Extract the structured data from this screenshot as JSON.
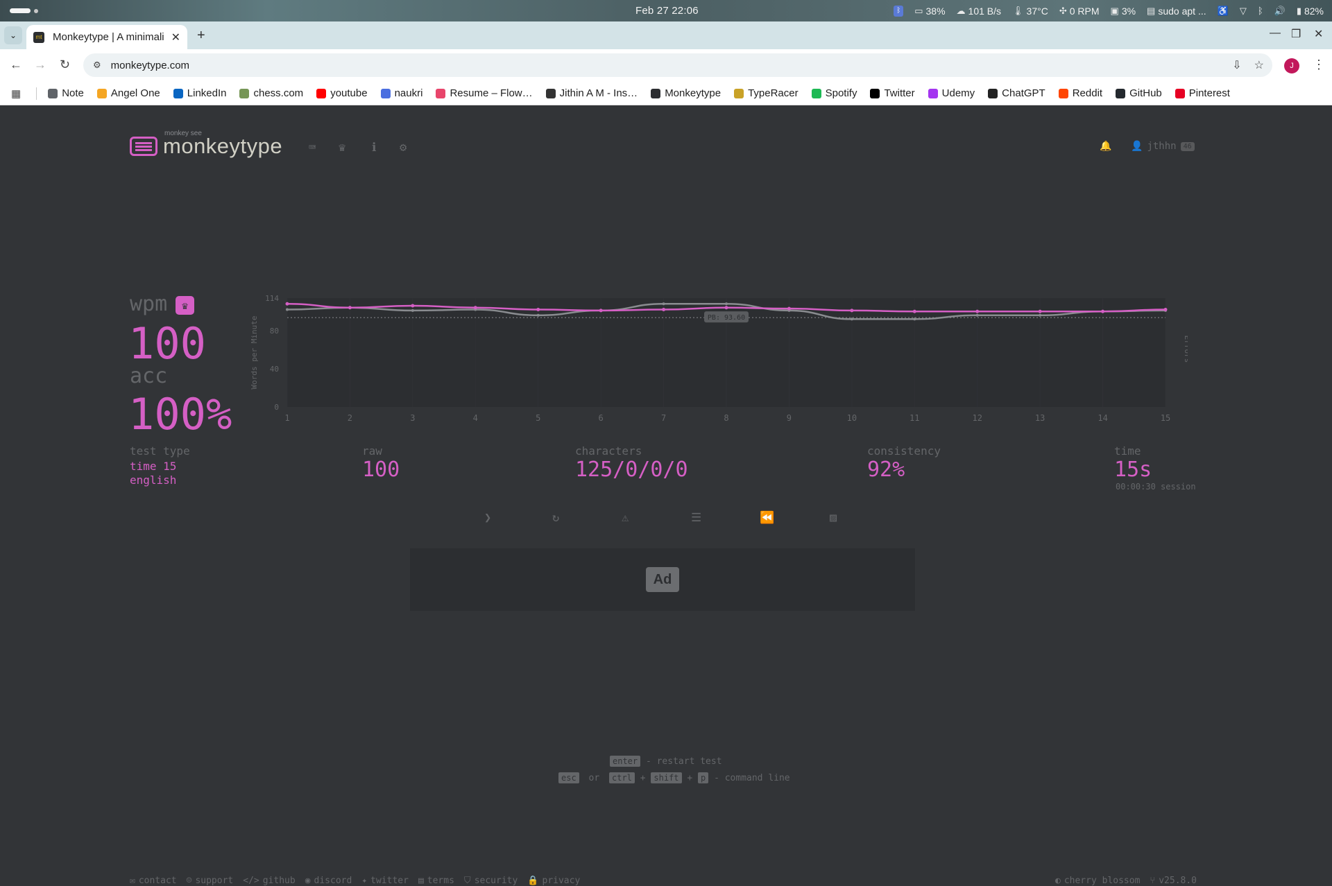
{
  "system": {
    "clock": "Feb 27  22:06",
    "battery_saver": "38%",
    "net_speed": "101 B/s",
    "temperature": "37°C",
    "fan": "0 RPM",
    "disk": "3%",
    "terminal": "sudo apt ...",
    "battery": "82%"
  },
  "browser": {
    "tab_title": "Monkeytype | A minimali",
    "url": "monkeytype.com",
    "avatar_letter": "J",
    "bookmarks": [
      {
        "label": "Note",
        "color": "#5f6368"
      },
      {
        "label": "Angel One",
        "color": "#f5a623"
      },
      {
        "label": "LinkedIn",
        "color": "#0a66c2"
      },
      {
        "label": "chess.com",
        "color": "#769656"
      },
      {
        "label": "youtube",
        "color": "#ff0000"
      },
      {
        "label": "naukri",
        "color": "#4a6ee0"
      },
      {
        "label": "Resume – Flow…",
        "color": "#e8456b"
      },
      {
        "label": "Jithin A M - Ins…",
        "color": "#333333"
      },
      {
        "label": "Monkeytype",
        "color": "#2c2e31"
      },
      {
        "label": "TypeRacer",
        "color": "#c9a227"
      },
      {
        "label": "Spotify",
        "color": "#1db954"
      },
      {
        "label": "Twitter",
        "color": "#000000"
      },
      {
        "label": "Udemy",
        "color": "#a435f0"
      },
      {
        "label": "ChatGPT",
        "color": "#222222"
      },
      {
        "label": "Reddit",
        "color": "#ff4500"
      },
      {
        "label": "GitHub",
        "color": "#24292e"
      },
      {
        "label": "Pinterest",
        "color": "#e60023"
      }
    ]
  },
  "header": {
    "logo_small": "monkey see",
    "logo_big": "monkeytype",
    "username": "jthhn",
    "level": "46"
  },
  "result": {
    "wpm_label": "wpm",
    "wpm": "100",
    "acc_label": "acc",
    "acc": "100%",
    "test_type_label": "test type",
    "test_type_1": "time 15",
    "test_type_2": "english",
    "raw_label": "raw",
    "raw": "100",
    "characters_label": "characters",
    "characters": "125/0/0/0",
    "consistency_label": "consistency",
    "consistency": "92%",
    "time_label": "time",
    "time": "15s",
    "session": "00:00:30 session"
  },
  "chart_data": {
    "type": "line",
    "x": [
      1,
      2,
      3,
      4,
      5,
      6,
      7,
      8,
      9,
      10,
      11,
      12,
      13,
      14,
      15
    ],
    "series": [
      {
        "values": [
          108,
          104,
          106,
          104,
          102,
          101,
          102,
          104,
          103,
          101,
          100,
          100,
          100,
          100,
          102
        ]
      },
      {
        "values": [
          102,
          104,
          101,
          102,
          96,
          101,
          108,
          108,
          101,
          92,
          92,
          96,
          96,
          100,
          101
        ]
      }
    ],
    "ylabel": "Words per Minute",
    "y2label": "Errors",
    "y_ticks": [
      "114",
      "80",
      "40",
      "0"
    ],
    "ylim": [
      0,
      114
    ],
    "pb_value": 93.6,
    "pb_label": "PB: 93.60",
    "colors": {
      "wpm": "#d55fc5",
      "raw": "#8a8c90",
      "pb": "#8a8c90"
    }
  },
  "hints": {
    "enter": "enter",
    "restart": "- restart test",
    "esc": "esc",
    "or": "or",
    "ctrl": "ctrl",
    "shift": "shift",
    "p": "p",
    "command": "- command line"
  },
  "footer": {
    "links": [
      "contact",
      "support",
      "github",
      "discord",
      "twitter",
      "terms",
      "security",
      "privacy"
    ],
    "theme": "cherry blossom",
    "version": "v25.8.0"
  }
}
